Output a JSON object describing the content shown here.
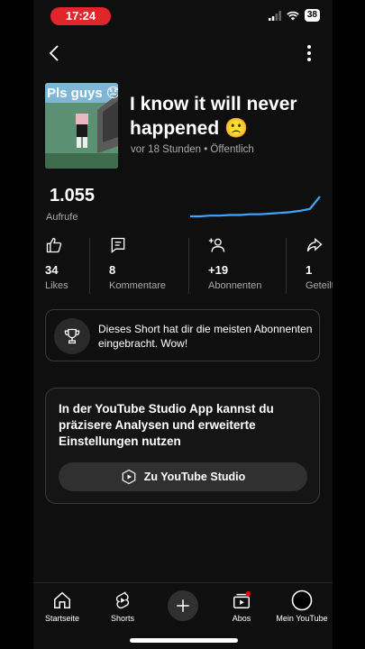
{
  "status": {
    "time": "17:24",
    "battery": "38"
  },
  "video": {
    "thumbnail_text": "Pls guys 😞",
    "title": "I know it will never happened 🙁",
    "meta": "vor 18 Stunden • Öffentlich"
  },
  "views": {
    "value": "1.055",
    "label": "Aufrufe",
    "trend": [
      1,
      1,
      2,
      2,
      3,
      3,
      4,
      4,
      5,
      6,
      7,
      9,
      12,
      30
    ]
  },
  "stats": [
    {
      "icon": "thumbs-up-icon",
      "value": "34",
      "label": "Likes"
    },
    {
      "icon": "comment-icon",
      "value": "8",
      "label": "Kommentare"
    },
    {
      "icon": "add-person-icon",
      "value": "+19",
      "label": "Abonnenten"
    },
    {
      "icon": "share-icon",
      "value": "1",
      "label": "Geteilt"
    }
  ],
  "info_card": {
    "text": "Dieses Short hat dir die meisten Abonnenten eingebracht. Wow!",
    "icon": "trophy-icon"
  },
  "studio_card": {
    "text": "In der YouTube Studio App kannst du präzisere Analysen und erweiterte Einstellungen nutzen",
    "button_label": "Zu YouTube Studio"
  },
  "nav": {
    "items": [
      {
        "label": "Startseite",
        "icon": "home-icon"
      },
      {
        "label": "Shorts",
        "icon": "shorts-icon"
      },
      {
        "label": "Abos",
        "icon": "subscriptions-icon"
      },
      {
        "label": "Mein YouTube",
        "icon": "profile-icon"
      }
    ]
  },
  "colors": {
    "time_pill": "#e0262b",
    "sparkline": "#3ea6ff",
    "notification_dot": "#ff0000"
  }
}
